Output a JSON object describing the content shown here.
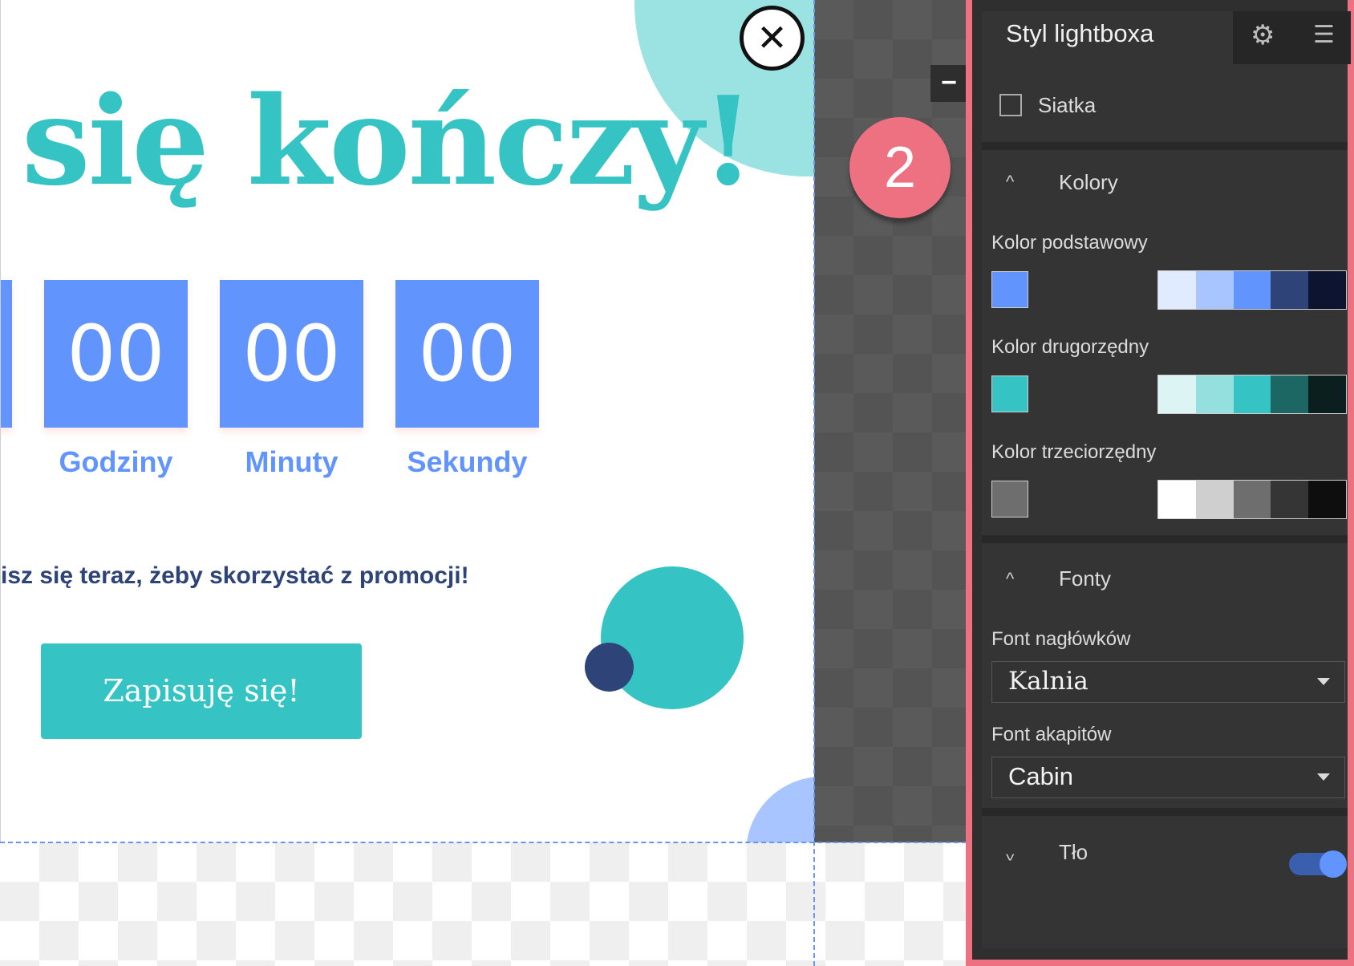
{
  "lightbox": {
    "headline": "się kończy!",
    "countdown": [
      {
        "value": "00",
        "label": "Godziny"
      },
      {
        "value": "00",
        "label": "Minuty"
      },
      {
        "value": "00",
        "label": "Sekundy"
      }
    ],
    "promo_text": "isz się teraz, żeby skorzystać z promocji!",
    "cta_label": "Zapisuję się!",
    "close_icon": "close-icon"
  },
  "step_badge": "2",
  "minus_label": "−",
  "panel": {
    "title": "Styl lightboxa",
    "tab_icons": [
      "gear-icon",
      "list-icon"
    ],
    "grid": {
      "label": "Siatka",
      "checked": false
    },
    "colors": {
      "section_title": "Kolory",
      "expanded": true,
      "primary": {
        "label": "Kolor podstawowy",
        "swatch": "#6194fd",
        "palette": [
          "#e1ebff",
          "#a9c5ff",
          "#6194fd",
          "#2e4479",
          "#0c1430"
        ]
      },
      "secondary": {
        "label": "Kolor drugorzędny",
        "swatch": "#35c3c3",
        "palette": [
          "#dcf5f4",
          "#94e0df",
          "#35c3c3",
          "#1c6663",
          "#0a1f1e"
        ]
      },
      "tertiary": {
        "label": "Kolor trzeciorzędny",
        "swatch": "#6e6e6e",
        "palette": [
          "#ffffff",
          "#cfcfcf",
          "#6e6e6e",
          "#353535",
          "#0e0e0e"
        ]
      }
    },
    "fonts": {
      "section_title": "Fonty",
      "expanded": true,
      "heading_label": "Font nagłówków",
      "heading_value": "Kalnia",
      "paragraph_label": "Font akapitów",
      "paragraph_value": "Cabin"
    },
    "background": {
      "section_title": "Tło",
      "expanded": false,
      "enabled": true
    }
  },
  "colors": {
    "teal": "#35c3c3",
    "blue": "#6194fd",
    "navy": "#2e4479",
    "accent_border": "#ee7182"
  }
}
